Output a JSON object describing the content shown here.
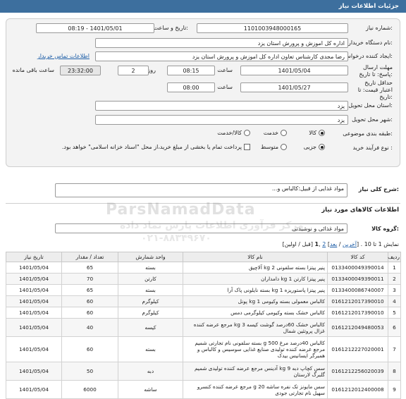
{
  "header": {
    "title": "جزئیات اطلاعات نیاز"
  },
  "form": {
    "need_number_label": "شماره نیاز:",
    "need_number": "1101003948000165",
    "announce_label": "تاریخ و ساعت اعلان عمومی:",
    "announce_value": "1401/05/01 - 08:19",
    "buyer_label": "نام دستگاه خریدار:",
    "buyer_value": "اداره کل اموزش و پرورش استان یزد",
    "creator_label": "ایجاد کننده درخواست:",
    "creator_value": "رضا مجدی کارشناس تعاون اداره کل اموزش و پرورش استان یزد",
    "contact_link": "اطلاعات تماس خریدار",
    "deadline_label": "مهلت ارسال پاسخ: تا تاریخ:",
    "deadline_date": "1401/05/04",
    "time_label": "ساعت",
    "deadline_time": "08:15",
    "days_value": "2",
    "days_label": "روز و",
    "remaining_time": "23:32:00",
    "remaining_label": "ساعت باقی مانده",
    "validity_label": "حداقل تاریخ اعتبار قیمت: تا تاریخ:",
    "validity_date": "1401/05/27",
    "validity_time_label": "ساعت",
    "validity_time": "08:00",
    "province_label": "استان محل تحویل:",
    "province_value": "یزد",
    "city_label": "شهر محل تحویل:",
    "city_value": "یزد",
    "category_label": "طبقه بندی موضوعی:",
    "category_options": [
      "کالا",
      "خدمت",
      "کالا/خدمت"
    ],
    "process_label": "نوع فرآیند خرید :",
    "process_options": [
      "جزیی",
      "متوسط"
    ],
    "payment_note": "پرداخت تمام یا بخشی از مبلغ خرید،از محل \"اسناد خزانه اسلامی\" خواهد بود."
  },
  "summary": {
    "label": "شرح کلی نیاز:",
    "value": "مواد غذایی از قبیل:کالباس و..."
  },
  "goods_section": {
    "title": "اطلاعات کالاهای مورد نیاز"
  },
  "group": {
    "label": "گروه کالا:",
    "value": "مواد غذائی و نوشیدنی"
  },
  "pager": {
    "prefix": "نمایش 1 تا 10 .",
    "last": "آخرین",
    "next": "بعد",
    "page2": "2",
    "page1": "1",
    "prev": "قبل",
    "first": "اولین"
  },
  "table": {
    "headers": [
      "ردیف",
      "کد کالا",
      "نام کالا",
      "واحد شمارش",
      "تعداد / مقدار",
      "تاریخ نیاز"
    ],
    "rows": [
      [
        "1",
        "0133400049390014",
        "پنیر پیتزا بسته سلفونی 2 kg آلاچیق",
        "بسته",
        "65",
        "1401/05/04"
      ],
      [
        "2",
        "0133400049390011",
        "پنیر پیتزا کارتن 1 kg دامداران",
        "کارتن",
        "70",
        "1401/05/04"
      ],
      [
        "3",
        "0133400086740007",
        "پنیر پیتزا پاستوریزه 1 kg بسته نایلونی پاک آرا",
        "بسته",
        "65",
        "1401/05/04"
      ],
      [
        "4",
        "0161212017390010",
        "کالباس معمولی بسته وکیومی 1 kg پونل",
        "کیلوگرم",
        "60",
        "1401/05/04"
      ],
      [
        "5",
        "0161212017390010",
        "کالباس خشک بسته وکیومی کیلوگرمی دمس",
        "کیلوگرم",
        "60",
        "1401/05/04"
      ],
      [
        "6",
        "0161212049480053",
        "کالباس خشک 60درصد گوشت کیسه 3 kg مرجع عرضه کننده غزال پروتئین شمال",
        "کیسه",
        "40",
        "1401/05/04"
      ],
      [
        "7",
        "0161212227020001",
        "کالباس 40درصد مرغ 500 g بسته سلفونی نام تجارتی شمیم مرجع عرضه کننده تولیدی صنایع غذایی سوسیس و کالباس و همبرگر ایسانیس بیدک",
        "بسته",
        "60",
        "1401/05/04"
      ],
      [
        "8",
        "0161212256020039",
        "سس کچاپ دبه 9 kg آدینس مرجع عرضه کننده تولیدی شمیم گلبرگ لارستان",
        "دبه",
        "50",
        "1401/05/04"
      ],
      [
        "9",
        "0161212012400008",
        "سس مایونز تک نفره ساشه 20 g مرجع عرضه کننده کنسرو سهیل نام تجارتی جودی",
        "ساشه",
        "6000",
        "1401/05/04"
      ]
    ]
  },
  "watermark": {
    "line1": "ParsNamadData",
    "line2": "مرکز فرآوری اطلاعات پارس نماد داده",
    "phone": "۰۲۱-۸۸۳۴۹۶۷۰"
  }
}
